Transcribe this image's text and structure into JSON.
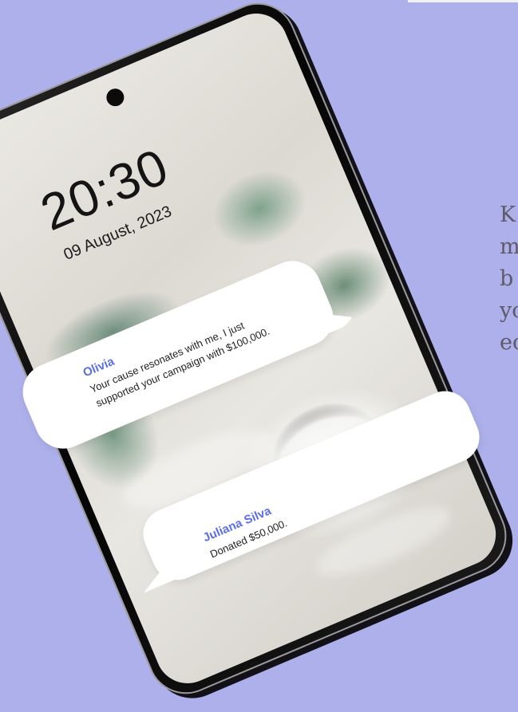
{
  "side_text": "K\nm\nb\nyo\nec",
  "lockscreen": {
    "time": "20:30",
    "date": "09 August, 2023"
  },
  "notifications": [
    {
      "name": "Olivia",
      "message": "Your cause resonates with me, I just supported your campaign with $100,000."
    },
    {
      "name": "Juliana Silva",
      "message": "Donated $50,000."
    }
  ],
  "colors": {
    "background": "#adb0ea",
    "accent_name": "#5b6ee8",
    "side_text": "#5f5a6a"
  }
}
